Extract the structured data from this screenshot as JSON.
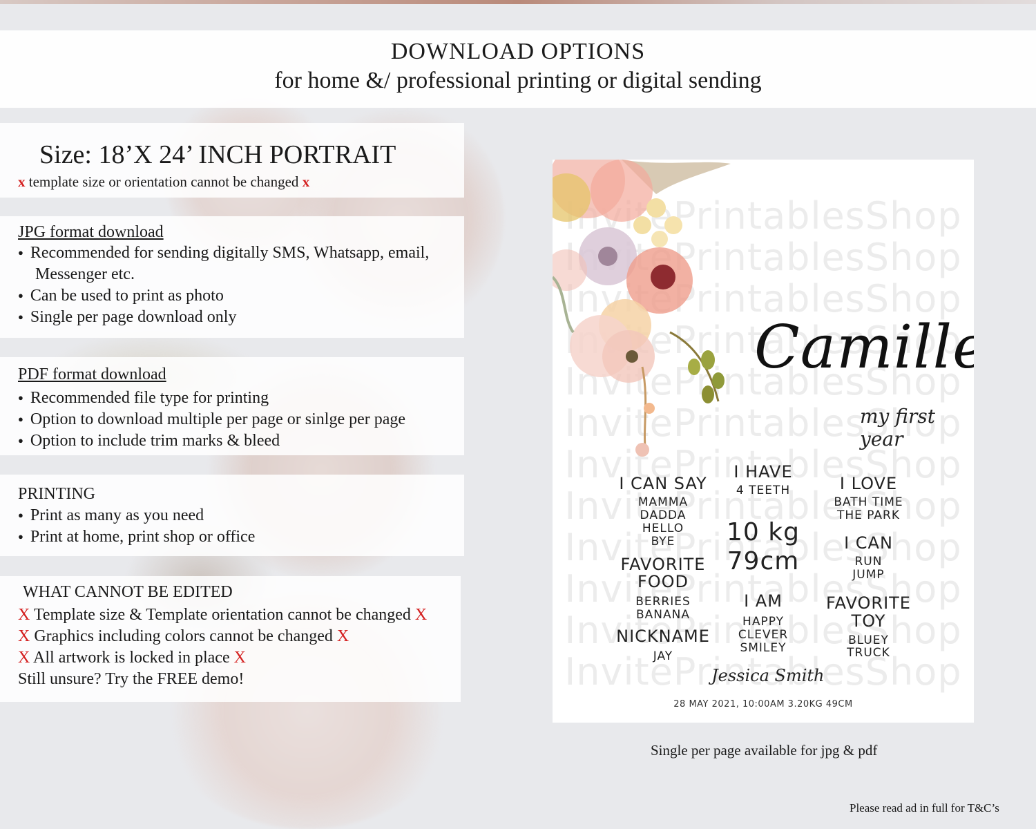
{
  "header": {
    "title": "DOWNLOAD OPTIONS",
    "subtitle": "for home &/ professional printing or digital sending"
  },
  "size": {
    "title": "Size: 18’X 24’ INCH PORTRAIT",
    "x_mark": "x",
    "note": "template size or orientation cannot be changed"
  },
  "jpg": {
    "heading": "JPG format download",
    "items": [
      "Recommended for sending digitally SMS, Whatsapp, email,",
      "Messenger etc.",
      "Can be used to print as photo",
      "Single per page download only"
    ]
  },
  "pdf": {
    "heading": "PDF format download",
    "items": [
      "Recommended file type for printing",
      "Option to download multiple per page or sinlge per page",
      "Option to include trim marks & bleed"
    ]
  },
  "printing": {
    "heading": "PRINTING",
    "items": [
      "Print as many as you need",
      "Print at home, print shop or office"
    ]
  },
  "cannot_edit": {
    "heading": "WHAT CANNOT BE EDITED",
    "x_mark": "X",
    "items": [
      "Template size & Template orientation cannot be changed",
      "Graphics including colors cannot be changed",
      "All artwork is locked in place"
    ],
    "demo": "Still unsure? Try the FREE demo!"
  },
  "poster": {
    "watermark": "InvitePrintablesShop",
    "name": "Camille",
    "tagline": "my first year",
    "can_say": {
      "heading": "I CAN SAY",
      "items": [
        "MAMMA",
        "DADDA",
        "HELLO",
        "BYE"
      ]
    },
    "have": {
      "heading": "I HAVE",
      "value": "4 TEETH"
    },
    "love": {
      "heading": "I LOVE",
      "items": [
        "BATH TIME",
        "THE PARK"
      ]
    },
    "weight": "10 kg",
    "height": "79cm",
    "can": {
      "heading": "I CAN",
      "items": [
        "RUN",
        "JUMP"
      ]
    },
    "food": {
      "heading_1": "FAVORITE",
      "heading_2": "FOOD",
      "items": [
        "BERRIES",
        "BANANA"
      ]
    },
    "am": {
      "heading": "I AM",
      "items": [
        "HAPPY",
        "CLEVER",
        "SMILEY"
      ]
    },
    "toy": {
      "heading_1": "FAVORITE",
      "heading_2": "TOY",
      "items": [
        "BLUEY",
        "TRUCK"
      ]
    },
    "nickname": {
      "heading": "NICKNAME",
      "value": "JAY"
    },
    "signature": "Jessica Smith",
    "footer": "28 MAY 2021, 10:00AM 3.20KG 49CM"
  },
  "caption": "Single per page available for jpg & pdf",
  "terms": "Please read ad in full for T&C’s",
  "colors": {
    "accent_red": "#d41f1f",
    "panel": "#ffffff",
    "background": "#e8e9ec"
  }
}
